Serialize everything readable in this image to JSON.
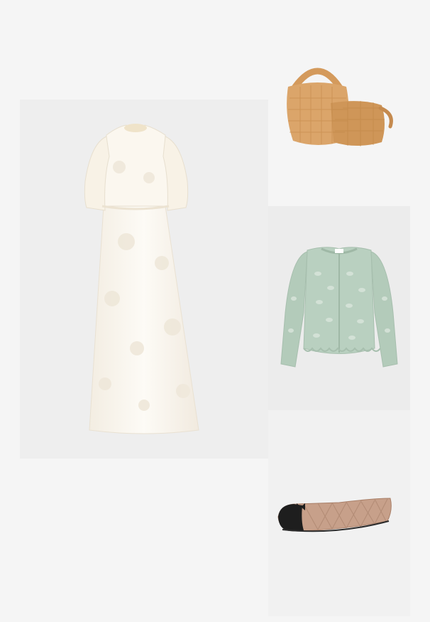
{
  "board": {
    "background": "#f5f5f5",
    "items": [
      {
        "name": "dress",
        "description_color": "#fbf8f1",
        "tile_color": "#eeeeee"
      },
      {
        "name": "bag",
        "description_color": "#d9a66a",
        "tile_color": "#f5f5f5"
      },
      {
        "name": "cardigan",
        "description_color": "#b8cfc0",
        "tile_color": "#ececec"
      },
      {
        "name": "flats",
        "description_color": "#c4a089",
        "tile_color": "#f1f1f1"
      }
    ]
  }
}
